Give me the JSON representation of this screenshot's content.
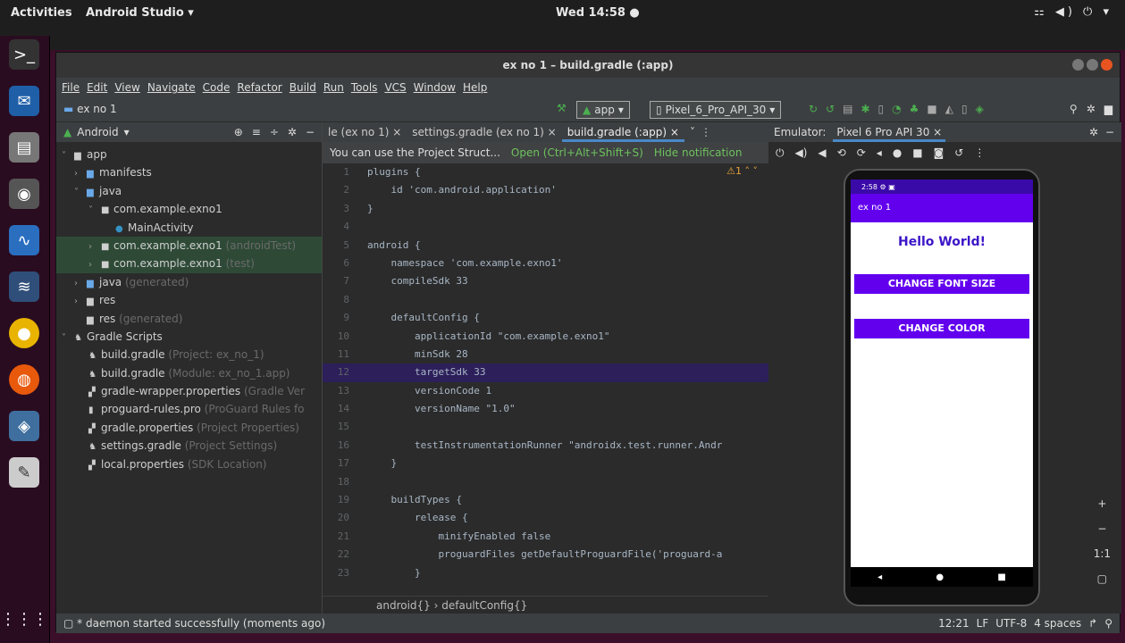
{
  "topbar": {
    "activities": "Activities",
    "app": "Android Studio ▾",
    "clock": "Wed 14:58 ●",
    "right": "⚏ ◀) ⏻ ▾"
  },
  "window": {
    "title": "ex no 1 – build.gradle (:app)"
  },
  "menu": [
    "File",
    "Edit",
    "View",
    "Navigate",
    "Code",
    "Refactor",
    "Build",
    "Run",
    "Tools",
    "VCS",
    "Window",
    "Help"
  ],
  "toolbar": {
    "project": "ex no 1",
    "run_config": "app",
    "device": "Pixel_6_Pro_API_30"
  },
  "project_panel": {
    "view": "Android",
    "tree": [
      {
        "label": "app",
        "dim": ""
      },
      {
        "label": "manifests",
        "dim": ""
      },
      {
        "label": "java",
        "dim": ""
      },
      {
        "label": "com.example.exno1",
        "dim": ""
      },
      {
        "label": "MainActivity",
        "dim": ""
      },
      {
        "label": "com.example.exno1",
        "dim": " (androidTest)"
      },
      {
        "label": "com.example.exno1",
        "dim": " (test)"
      },
      {
        "label": "java",
        "dim": " (generated)"
      },
      {
        "label": "res",
        "dim": ""
      },
      {
        "label": "res",
        "dim": " (generated)"
      },
      {
        "label": "Gradle Scripts",
        "dim": ""
      },
      {
        "label": "build.gradle",
        "dim": " (Project: ex_no_1)"
      },
      {
        "label": "build.gradle",
        "dim": " (Module: ex_no_1.app)"
      },
      {
        "label": "gradle-wrapper.properties",
        "dim": " (Gradle Ver"
      },
      {
        "label": "proguard-rules.pro",
        "dim": " (ProGuard Rules fo"
      },
      {
        "label": "gradle.properties",
        "dim": " (Project Properties)"
      },
      {
        "label": "settings.gradle",
        "dim": " (Project Settings)"
      },
      {
        "label": "local.properties",
        "dim": " (SDK Location)"
      }
    ]
  },
  "editor": {
    "tabs": [
      "le (ex no 1) ×",
      "settings.gradle (ex no 1) ×",
      "build.gradle (:app) ×"
    ],
    "notification": "You can use the Project Struct...",
    "notif_open": "Open (Ctrl+Alt+Shift+S)",
    "notif_hide": "Hide notification",
    "warning": "⚠1 ˄ ˅",
    "lines": [
      {
        "n": "1",
        "t": "plugins {"
      },
      {
        "n": "2",
        "t": "    id 'com.android.application'"
      },
      {
        "n": "3",
        "t": "}"
      },
      {
        "n": "4",
        "t": ""
      },
      {
        "n": "5",
        "t": "android {"
      },
      {
        "n": "6",
        "t": "    namespace 'com.example.exno1'"
      },
      {
        "n": "7",
        "t": "    compileSdk 33"
      },
      {
        "n": "8",
        "t": ""
      },
      {
        "n": "9",
        "t": "    defaultConfig {"
      },
      {
        "n": "10",
        "t": "        applicationId \"com.example.exno1\""
      },
      {
        "n": "11",
        "t": "        minSdk 28"
      },
      {
        "n": "12",
        "t": "        targetSdk 33"
      },
      {
        "n": "13",
        "t": "        versionCode 1"
      },
      {
        "n": "14",
        "t": "        versionName \"1.0\""
      },
      {
        "n": "15",
        "t": ""
      },
      {
        "n": "16",
        "t": "        testInstrumentationRunner \"androidx.test.runner.Andr"
      },
      {
        "n": "17",
        "t": "    }"
      },
      {
        "n": "18",
        "t": ""
      },
      {
        "n": "19",
        "t": "    buildTypes {"
      },
      {
        "n": "20",
        "t": "        release {"
      },
      {
        "n": "21",
        "t": "            minifyEnabled false"
      },
      {
        "n": "22",
        "t": "            proguardFiles getDefaultProguardFile('proguard-a"
      },
      {
        "n": "23",
        "t": "        }"
      }
    ],
    "current_line": "12",
    "breadcrumb": "android{}  ›  defaultConfig{}"
  },
  "emulator": {
    "label": "Emulator:",
    "device_tab": "Pixel 6 Pro API 30 ×",
    "phone": {
      "status": "2:58 ⚙ ▣",
      "app_title": "ex no 1",
      "hello": "Hello World!",
      "btn_font": "CHANGE FONT SIZE",
      "btn_color": "CHANGE COLOR"
    },
    "zoom": [
      "+",
      "−",
      "1:1",
      "▢"
    ]
  },
  "statusbar": {
    "message": "* daemon started successfully (moments ago)",
    "position": "12:21",
    "lf": "LF",
    "enc": "UTF-8",
    "indent": "4 spaces"
  }
}
